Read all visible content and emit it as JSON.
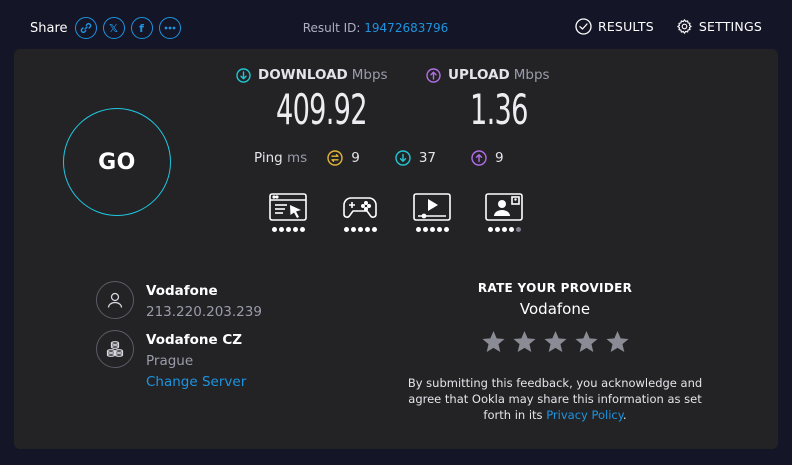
{
  "topbar": {
    "share_label": "Share",
    "share_buttons": [
      {
        "icon": "link-icon"
      },
      {
        "icon": "x-icon",
        "text": "𝕏"
      },
      {
        "icon": "facebook-icon",
        "text": "f"
      },
      {
        "icon": "more-icon"
      }
    ],
    "result_label": "Result ID:",
    "result_id": "19472683796",
    "results_label": "RESULTS",
    "settings_label": "SETTINGS"
  },
  "go_label": "GO",
  "download": {
    "label": "DOWNLOAD",
    "unit": "Mbps",
    "value": "409.92"
  },
  "upload": {
    "label": "UPLOAD",
    "unit": "Mbps",
    "value": "1.36"
  },
  "ping": {
    "label": "Ping",
    "unit": "ms",
    "idle": "9",
    "download": "37",
    "upload": "9"
  },
  "app_ratings": [
    {
      "icon": "web-browsing-icon",
      "rating": 5,
      "max": 5
    },
    {
      "icon": "gaming-icon",
      "rating": 5,
      "max": 5
    },
    {
      "icon": "video-streaming-icon",
      "rating": 5,
      "max": 5
    },
    {
      "icon": "video-call-icon",
      "rating": 4,
      "max": 5
    }
  ],
  "isp": {
    "name": "Vodafone",
    "ip": "213.220.203.239"
  },
  "server": {
    "name": "Vodafone CZ",
    "city": "Prague",
    "change_label": "Change Server"
  },
  "rate": {
    "title": "RATE YOUR PROVIDER",
    "provider": "Vodafone",
    "stars": 5,
    "disclaimer_pre": "By submitting this feedback, you acknowledge and agree that Ookla may share this information as set forth in its",
    "privacy_link": "Privacy Policy",
    "disclaimer_post": "."
  },
  "colors": {
    "accent_blue": "#1c94e0",
    "download_teal": "#1fc7d4",
    "upload_purple": "#b26ee6",
    "idle_yellow": "#e3b636",
    "panel": "#232326",
    "background": "#141526"
  }
}
